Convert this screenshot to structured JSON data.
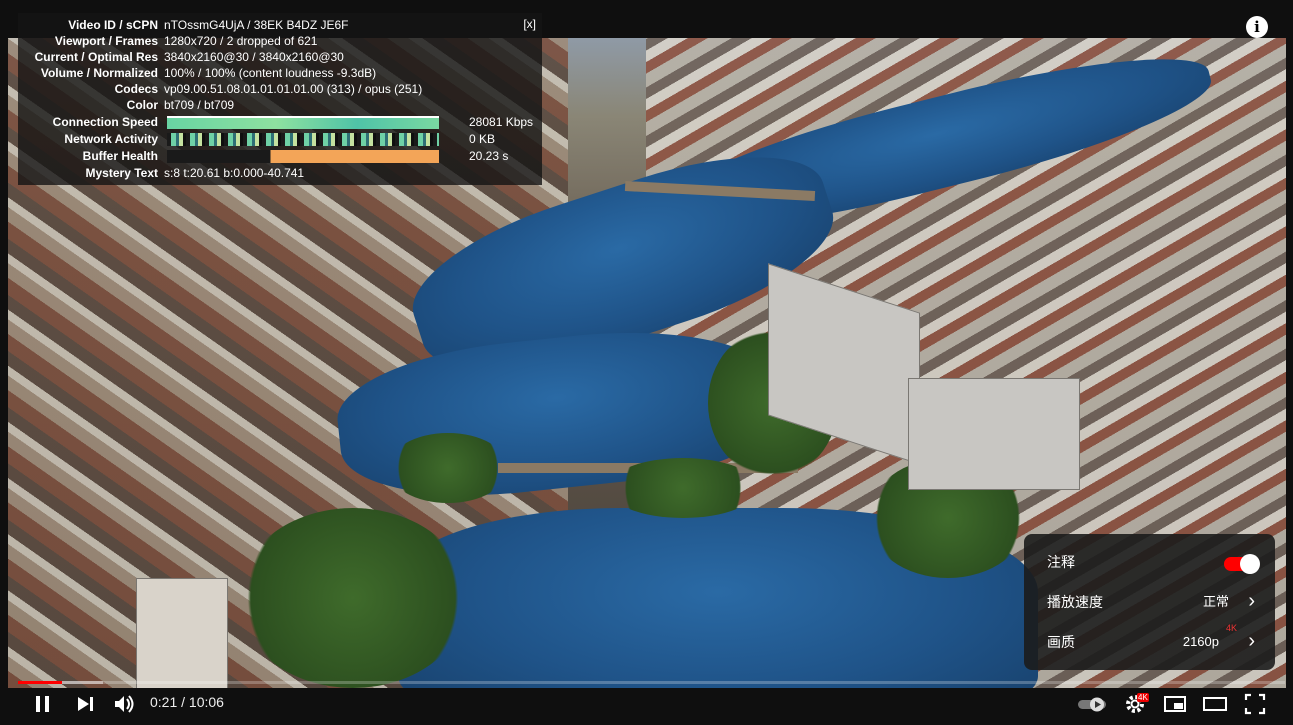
{
  "stats": {
    "close_label": "[x]",
    "rows": [
      {
        "label": "Video ID / sCPN",
        "value": "nTOssmG4UjA / 38EK B4DZ JE6F"
      },
      {
        "label": "Viewport / Frames",
        "value": "1280x720 / 2 dropped of 621"
      },
      {
        "label": "Current / Optimal Res",
        "value": "3840x2160@30 / 3840x2160@30"
      },
      {
        "label": "Volume / Normalized",
        "value": "100% / 100% (content loudness -9.3dB)"
      },
      {
        "label": "Codecs",
        "value": "vp09.00.51.08.01.01.01.01.00 (313) / opus (251)"
      },
      {
        "label": "Color",
        "value": "bt709 / bt709"
      },
      {
        "label": "Connection Speed",
        "value": "28081 Kbps"
      },
      {
        "label": "Network Activity",
        "value": "0 KB"
      },
      {
        "label": "Buffer Health",
        "value": "20.23 s"
      },
      {
        "label": "Mystery Text",
        "value": "s:8 t:20.61 b:0.000-40.741"
      }
    ]
  },
  "settings_menu": {
    "items": [
      {
        "label": "注释",
        "value": ""
      },
      {
        "label": "播放速度",
        "value": "正常"
      },
      {
        "label": "画质",
        "value": "2160p",
        "badge": "4K"
      }
    ],
    "annotations_on": true,
    "chevron": "›"
  },
  "controls": {
    "time": "0:21 / 10:06",
    "progress_fraction": 0.035,
    "buffered_fraction": 0.067,
    "settings_badge": "4K",
    "icons": [
      "pause-icon",
      "next-icon",
      "volume-icon",
      "autoplay-toggle-icon",
      "settings-gear-icon",
      "miniplayer-icon",
      "theater-mode-icon",
      "fullscreen-icon"
    ]
  },
  "info_icon": "i",
  "colors": {
    "accent": "#ff0000",
    "badge": "#e33333"
  }
}
